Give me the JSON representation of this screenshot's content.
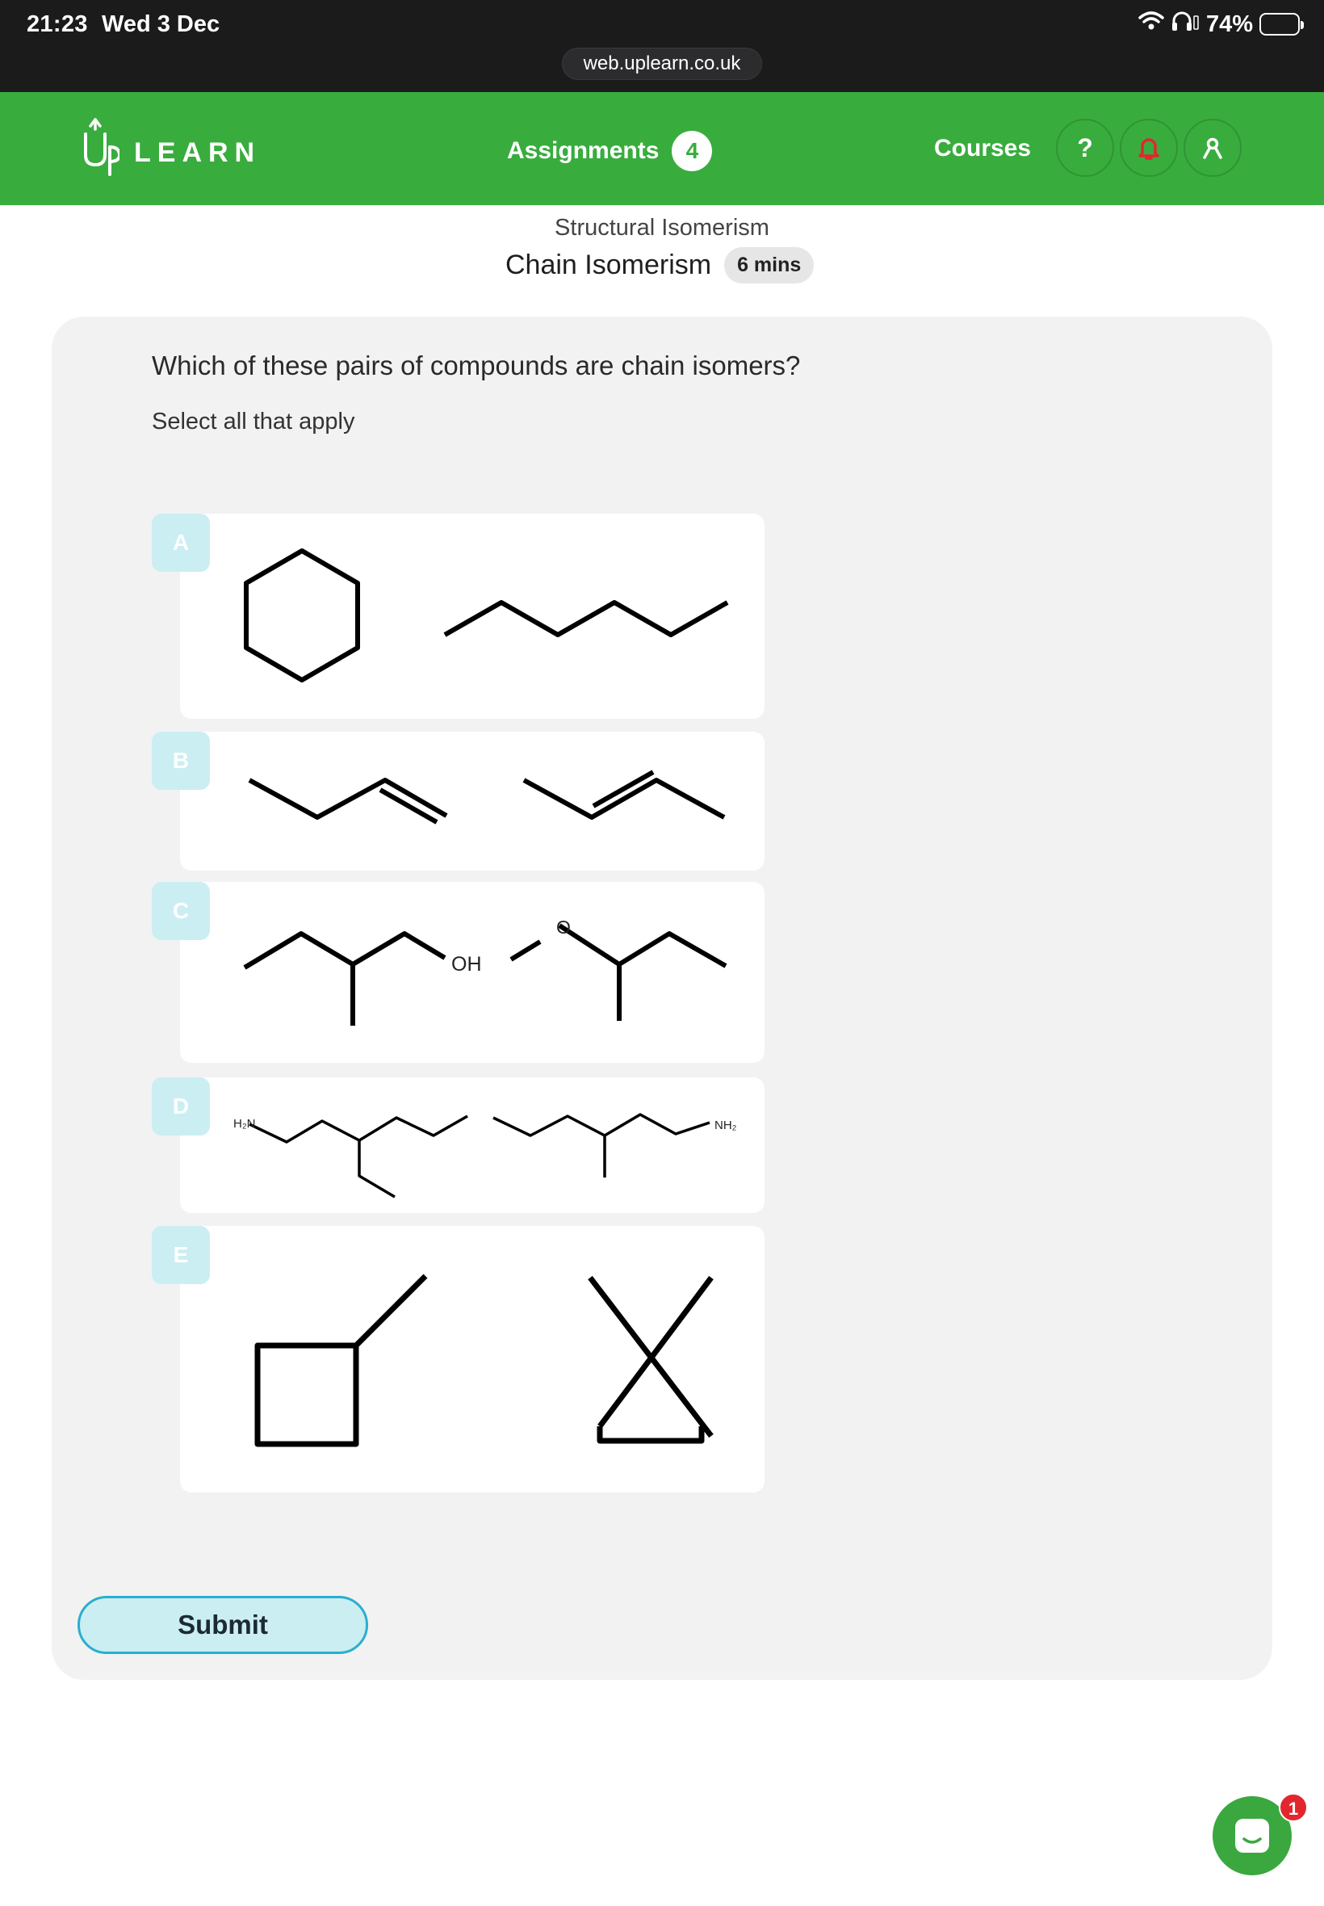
{
  "status_bar": {
    "time": "21:23",
    "date": "Wed 3 Dec",
    "battery": "74%",
    "url": "web.uplearn.co.uk"
  },
  "nav": {
    "logo_up": "Up",
    "logo_learn": "LEARN",
    "assignments_label": "Assignments",
    "assignments_count": "4",
    "courses_label": "Courses",
    "help_label": "?",
    "accent_color": "#39ac3e",
    "icons": [
      "help-icon",
      "bell-icon",
      "user-icon"
    ]
  },
  "header": {
    "topic": "Structural Isomerism",
    "lesson": "Chain Isomerism",
    "duration": "6 mins"
  },
  "question": {
    "text": "Which of these pairs of compounds are chain isomers?",
    "hint": "Select all that apply",
    "options": [
      {
        "letter": "A"
      },
      {
        "letter": "B"
      },
      {
        "letter": "C",
        "labels": [
          "OH",
          "O"
        ]
      },
      {
        "letter": "D",
        "labels": [
          "H₂N",
          "NH₂"
        ]
      },
      {
        "letter": "E"
      }
    ],
    "submit_label": "Submit"
  },
  "chat": {
    "badge": "1"
  }
}
